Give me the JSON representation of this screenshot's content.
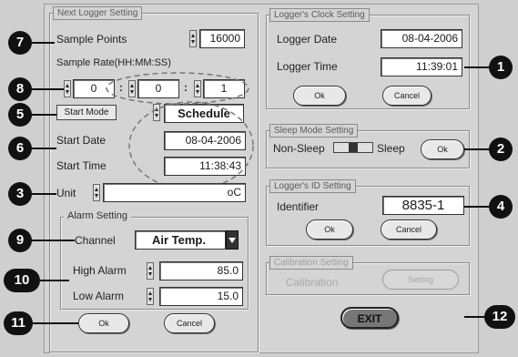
{
  "next_logger": {
    "title": "Next Logger Setting",
    "sample_points_label": "Sample Points",
    "sample_points_value": "16000",
    "sample_rate_label": "Sample Rate(HH:MM:SS)",
    "rate_hh": "0",
    "rate_mm": "0",
    "rate_ss": "1",
    "colon": ":",
    "start_mode_button": "Start Mode",
    "start_mode_value": "Schedule",
    "start_date_label": "Start Date",
    "start_date_value": "08-04-2006",
    "start_time_label": "Start Time",
    "start_time_value": "11:38:43",
    "unit_label": "Unit",
    "unit_value": "oC",
    "ok_button": "Ok",
    "cancel_button": "Cancel"
  },
  "alarm": {
    "title": "Alarm  Setting",
    "channel_label": "Channel",
    "channel_value": "Air Temp.",
    "high_label": "High Alarm",
    "high_value": "85.0",
    "low_label": "Low Alarm",
    "low_value": "15.0"
  },
  "clock": {
    "title": "Logger's Clock Setting",
    "date_label": "Logger Date",
    "date_value": "08-04-2006",
    "time_label": "Logger Time",
    "time_value": "11:39:01",
    "ok_button": "Ok",
    "cancel_button": "Cancel"
  },
  "sleep": {
    "title": "Sleep Mode Setting",
    "non_sleep_label": "Non-Sleep",
    "sleep_label": "Sleep",
    "ok_button": "Ok"
  },
  "logger_id": {
    "title": "Logger's ID Setting",
    "identifier_label": "Identifier",
    "identifier_value": "8835-1",
    "ok_button": "Ok",
    "cancel_button": "Cancel"
  },
  "calibration": {
    "title": "Calibration Setting",
    "label": "Calibration",
    "setting_button": "Setting"
  },
  "exit_button": "EXIT",
  "markers": [
    "1",
    "2",
    "3",
    "4",
    "5",
    "6",
    "7",
    "8",
    "9",
    "10",
    "11",
    "12"
  ]
}
